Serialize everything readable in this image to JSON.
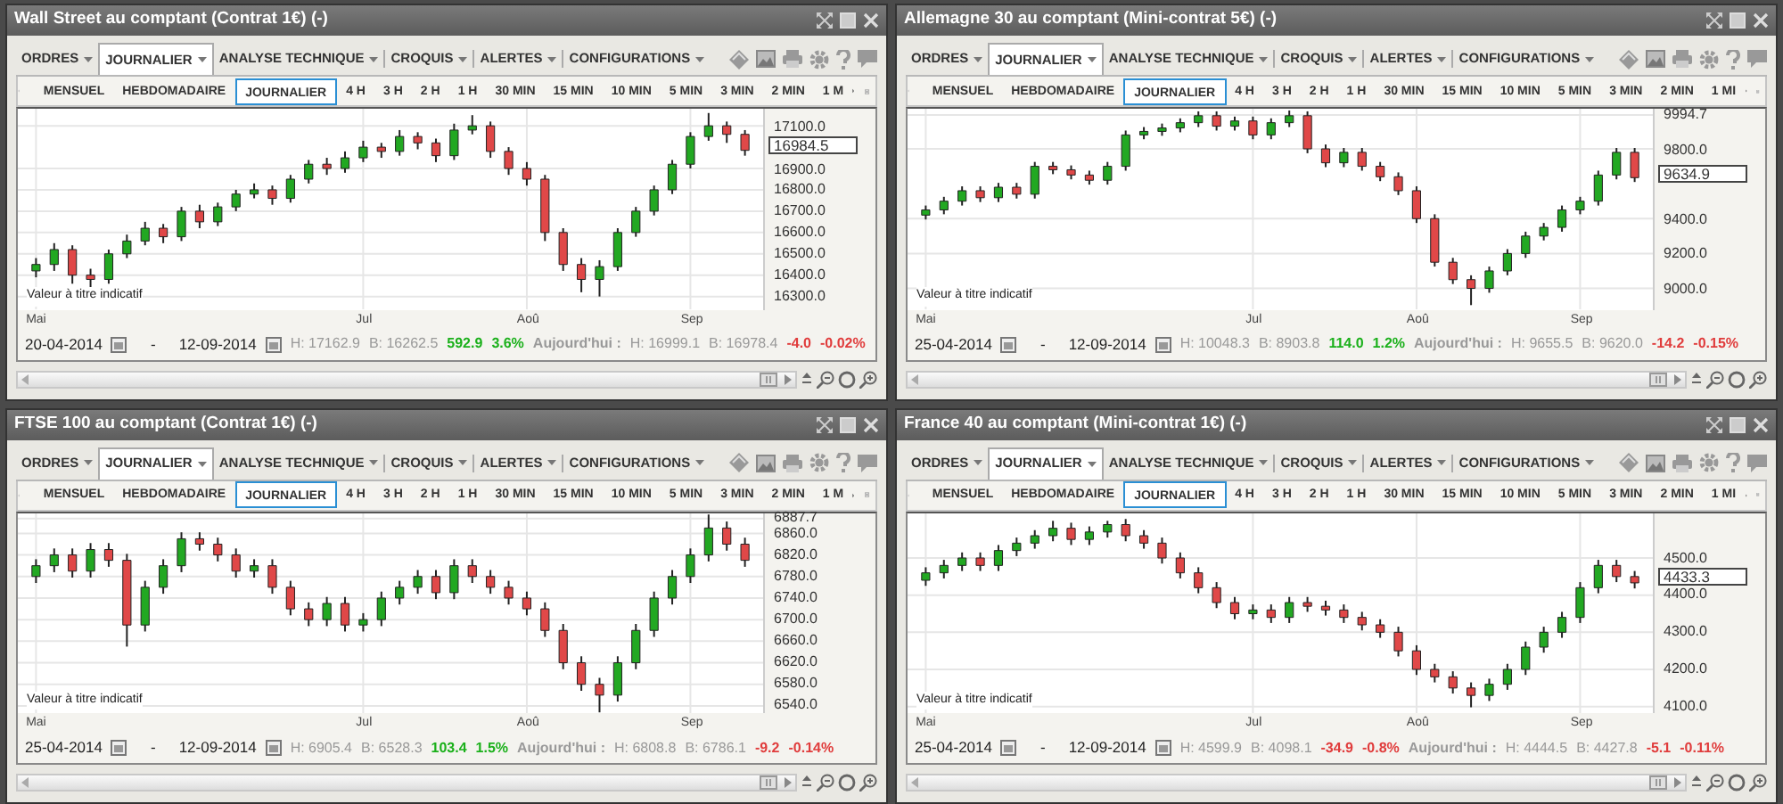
{
  "panels": [
    {
      "title": "Wall Street au comptant (Contrat 1€) (-)",
      "menu": [
        {
          "label": "ORDRES",
          "selected": false
        },
        {
          "label": "JOURNALIER",
          "selected": true
        },
        {
          "label": "ANALYSE TECHNIQUE",
          "selected": false
        },
        {
          "label": "CROQUIS",
          "selected": false
        },
        {
          "label": "ALERTES",
          "selected": false
        },
        {
          "label": "CONFIGURATIONS",
          "selected": false
        }
      ],
      "timeframes": [
        {
          "label": "MENSUEL",
          "selected": false
        },
        {
          "label": "HEBDOMADAIRE",
          "selected": false
        },
        {
          "label": "JOURNALIER",
          "selected": true
        },
        {
          "label": "4 H",
          "selected": false
        },
        {
          "label": "3 H",
          "selected": false
        },
        {
          "label": "2 H",
          "selected": false
        },
        {
          "label": "1 H",
          "selected": false
        },
        {
          "label": "30 MIN",
          "selected": false
        },
        {
          "label": "15 MIN",
          "selected": false
        },
        {
          "label": "10 MIN",
          "selected": false
        },
        {
          "label": "5 MIN",
          "selected": false
        },
        {
          "label": "3 MIN",
          "selected": false
        },
        {
          "label": "2 MIN",
          "selected": false
        },
        {
          "label": "1 M",
          "selected": false
        }
      ],
      "chart_data": {
        "type": "candlestick",
        "grid": true,
        "categories": [
          "Mai",
          null,
          null,
          null,
          null,
          null,
          null,
          null,
          null,
          null,
          null,
          null,
          null,
          null,
          null,
          null,
          null,
          null,
          "Jul",
          null,
          null,
          null,
          null,
          null,
          null,
          null,
          null,
          "Aoû",
          null,
          null,
          null,
          null,
          null,
          null,
          null,
          null,
          "Sep",
          null,
          null,
          null
        ],
        "ylim": [
          16240,
          17180
        ],
        "yticks": [
          {
            "value": 17100,
            "label": "17100.0"
          },
          {
            "value": 16900,
            "label": "16900.0"
          },
          {
            "value": 16800,
            "label": "16800.0"
          },
          {
            "value": 16700,
            "label": "16700.0"
          },
          {
            "value": 16600,
            "label": "16600.0"
          },
          {
            "value": 16500,
            "label": "16500.0"
          },
          {
            "value": 16400,
            "label": "16400.0"
          },
          {
            "value": 16300,
            "label": "16300.0"
          }
        ],
        "ohlc": [
          [
            16420,
            16480,
            16390,
            16450
          ],
          [
            16450,
            16550,
            16420,
            16520
          ],
          [
            16520,
            16540,
            16360,
            16400
          ],
          [
            16400,
            16430,
            16340,
            16380
          ],
          [
            16380,
            16520,
            16360,
            16500
          ],
          [
            16500,
            16590,
            16480,
            16560
          ],
          [
            16560,
            16650,
            16540,
            16620
          ],
          [
            16620,
            16640,
            16550,
            16580
          ],
          [
            16580,
            16720,
            16560,
            16700
          ],
          [
            16700,
            16730,
            16620,
            16650
          ],
          [
            16650,
            16740,
            16630,
            16720
          ],
          [
            16720,
            16800,
            16700,
            16780
          ],
          [
            16780,
            16830,
            16760,
            16800
          ],
          [
            16800,
            16820,
            16730,
            16760
          ],
          [
            16760,
            16870,
            16740,
            16850
          ],
          [
            16850,
            16940,
            16830,
            16920
          ],
          [
            16920,
            16950,
            16870,
            16900
          ],
          [
            16900,
            16980,
            16880,
            16950
          ],
          [
            16950,
            17030,
            16930,
            17000
          ],
          [
            17000,
            17020,
            16950,
            16980
          ],
          [
            16980,
            17080,
            16960,
            17050
          ],
          [
            17050,
            17070,
            16990,
            17020
          ],
          [
            17020,
            17040,
            16930,
            16960
          ],
          [
            16960,
            17110,
            16940,
            17080
          ],
          [
            17080,
            17150,
            17060,
            17100
          ],
          [
            17100,
            17120,
            16950,
            16980
          ],
          [
            16980,
            17000,
            16870,
            16900
          ],
          [
            16900,
            16930,
            16820,
            16850
          ],
          [
            16850,
            16870,
            16560,
            16600
          ],
          [
            16600,
            16620,
            16420,
            16450
          ],
          [
            16450,
            16480,
            16320,
            16380
          ],
          [
            16380,
            16470,
            16300,
            16440
          ],
          [
            16440,
            16620,
            16420,
            16600
          ],
          [
            16600,
            16720,
            16580,
            16700
          ],
          [
            16700,
            16820,
            16680,
            16800
          ],
          [
            16800,
            16940,
            16780,
            16920
          ],
          [
            16920,
            17070,
            16900,
            17050
          ],
          [
            17050,
            17160,
            17030,
            17100
          ],
          [
            17100,
            17120,
            17020,
            17060
          ],
          [
            17060,
            17080,
            16960,
            16985
          ]
        ]
      },
      "price": "16984.5",
      "note": "Valeur à titre indicatif",
      "footer": {
        "from": "20-04-2014",
        "separator": "-",
        "to": "12-09-2014",
        "high": "H: 17162.9",
        "low": "B: 16262.5",
        "change": {
          "value": "592.9",
          "percent": "3.6%",
          "color": "#1bb01b"
        },
        "today_label": "Aujourd'hui :",
        "today_high": "H: 16999.1",
        "today_low": "B: 16978.4",
        "today_change": {
          "value": "-4.0",
          "percent": "-0.02%",
          "color": "#e03c3c"
        }
      }
    },
    {
      "title": "Allemagne 30 au comptant (Mini-contrat 5€) (-)",
      "menu": [
        {
          "label": "ORDRES",
          "selected": false
        },
        {
          "label": "JOURNALIER",
          "selected": true
        },
        {
          "label": "ANALYSE TECHNIQUE",
          "selected": false
        },
        {
          "label": "CROQUIS",
          "selected": false
        },
        {
          "label": "ALERTES",
          "selected": false
        },
        {
          "label": "CONFIGURATIONS",
          "selected": false
        }
      ],
      "timeframes": [
        {
          "label": "MENSUEL",
          "selected": false
        },
        {
          "label": "HEBDOMADAIRE",
          "selected": false
        },
        {
          "label": "JOURNALIER",
          "selected": true
        },
        {
          "label": "4 H",
          "selected": false
        },
        {
          "label": "3 H",
          "selected": false
        },
        {
          "label": "2 H",
          "selected": false
        },
        {
          "label": "1 H",
          "selected": false
        },
        {
          "label": "30 MIN",
          "selected": false
        },
        {
          "label": "15 MIN",
          "selected": false
        },
        {
          "label": "10 MIN",
          "selected": false
        },
        {
          "label": "5 MIN",
          "selected": false
        },
        {
          "label": "3 MIN",
          "selected": false
        },
        {
          "label": "2 MIN",
          "selected": false
        },
        {
          "label": "1 MI",
          "selected": false
        }
      ],
      "chart_data": {
        "type": "candlestick",
        "grid": true,
        "categories": [
          "Mai",
          null,
          null,
          null,
          null,
          null,
          null,
          null,
          null,
          null,
          null,
          null,
          null,
          null,
          null,
          null,
          null,
          null,
          "Jul",
          null,
          null,
          null,
          null,
          null,
          null,
          null,
          null,
          "Aoû",
          null,
          null,
          null,
          null,
          null,
          null,
          null,
          null,
          "Sep",
          null,
          null,
          null
        ],
        "ylim": [
          8880,
          10030
        ],
        "yticks": [
          {
            "value": 9994.7,
            "label": "9994.7"
          },
          {
            "value": 9800,
            "label": "9800.0"
          },
          {
            "value": 9400,
            "label": "9400.0"
          },
          {
            "value": 9200,
            "label": "9200.0"
          },
          {
            "value": 9000,
            "label": "9000.0"
          }
        ],
        "ohlc": [
          [
            9420,
            9475,
            9395,
            9450
          ],
          [
            9450,
            9525,
            9425,
            9500
          ],
          [
            9500,
            9585,
            9475,
            9560
          ],
          [
            9560,
            9585,
            9495,
            9520
          ],
          [
            9520,
            9605,
            9495,
            9580
          ],
          [
            9580,
            9605,
            9515,
            9540
          ],
          [
            9540,
            9725,
            9515,
            9700
          ],
          [
            9700,
            9725,
            9655,
            9680
          ],
          [
            9680,
            9705,
            9625,
            9650
          ],
          [
            9650,
            9675,
            9595,
            9620
          ],
          [
            9620,
            9725,
            9595,
            9700
          ],
          [
            9700,
            9905,
            9675,
            9880
          ],
          [
            9880,
            9925,
            9855,
            9900
          ],
          [
            9900,
            9945,
            9875,
            9920
          ],
          [
            9920,
            9975,
            9895,
            9950
          ],
          [
            9950,
            10015,
            9925,
            9990
          ],
          [
            9990,
            10015,
            9905,
            9930
          ],
          [
            9930,
            9985,
            9905,
            9960
          ],
          [
            9960,
            9985,
            9855,
            9880
          ],
          [
            9880,
            9975,
            9855,
            9950
          ],
          [
            9950,
            10020,
            9925,
            9990
          ],
          [
            9990,
            10015,
            9775,
            9800
          ],
          [
            9800,
            9825,
            9695,
            9720
          ],
          [
            9720,
            9805,
            9695,
            9780
          ],
          [
            9780,
            9805,
            9675,
            9700
          ],
          [
            9700,
            9725,
            9615,
            9640
          ],
          [
            9640,
            9665,
            9535,
            9560
          ],
          [
            9560,
            9585,
            9375,
            9400
          ],
          [
            9400,
            9425,
            9125,
            9150
          ],
          [
            9150,
            9175,
            9025,
            9050
          ],
          [
            9050,
            9075,
            8904,
            9000
          ],
          [
            9000,
            9125,
            8975,
            9100
          ],
          [
            9100,
            9225,
            9075,
            9200
          ],
          [
            9200,
            9325,
            9175,
            9300
          ],
          [
            9300,
            9375,
            9275,
            9350
          ],
          [
            9350,
            9475,
            9325,
            9450
          ],
          [
            9450,
            9525,
            9425,
            9500
          ],
          [
            9500,
            9675,
            9475,
            9650
          ],
          [
            9650,
            9805,
            9625,
            9780
          ],
          [
            9780,
            9805,
            9610,
            9635
          ]
        ]
      },
      "price": "9634.9",
      "note": "Valeur à titre indicatif",
      "footer": {
        "from": "25-04-2014",
        "separator": "-",
        "to": "12-09-2014",
        "high": "H: 10048.3",
        "low": "B: 8903.8",
        "change": {
          "value": "114.0",
          "percent": "1.2%",
          "color": "#1bb01b"
        },
        "today_label": "Aujourd'hui :",
        "today_high": "H: 9655.5",
        "today_low": "B: 9620.0",
        "today_change": {
          "value": "-14.2",
          "percent": "-0.15%",
          "color": "#e03c3c"
        }
      }
    },
    {
      "title": "FTSE 100 au comptant (Contrat 1€) (-)",
      "menu": [
        {
          "label": "ORDRES",
          "selected": false
        },
        {
          "label": "JOURNALIER",
          "selected": true
        },
        {
          "label": "ANALYSE TECHNIQUE",
          "selected": false
        },
        {
          "label": "CROQUIS",
          "selected": false
        },
        {
          "label": "ALERTES",
          "selected": false
        },
        {
          "label": "CONFIGURATIONS",
          "selected": false
        }
      ],
      "timeframes": [
        {
          "label": "MENSUEL",
          "selected": false
        },
        {
          "label": "HEBDOMADAIRE",
          "selected": false
        },
        {
          "label": "JOURNALIER",
          "selected": true
        },
        {
          "label": "4 H",
          "selected": false
        },
        {
          "label": "3 H",
          "selected": false
        },
        {
          "label": "2 H",
          "selected": false
        },
        {
          "label": "1 H",
          "selected": false
        },
        {
          "label": "30 MIN",
          "selected": false
        },
        {
          "label": "15 MIN",
          "selected": false
        },
        {
          "label": "10 MIN",
          "selected": false
        },
        {
          "label": "5 MIN",
          "selected": false
        },
        {
          "label": "3 MIN",
          "selected": false
        },
        {
          "label": "2 MIN",
          "selected": false
        },
        {
          "label": "1 M",
          "selected": false
        }
      ],
      "chart_data": {
        "type": "candlestick",
        "grid": true,
        "categories": [
          "Mai",
          null,
          null,
          null,
          null,
          null,
          null,
          null,
          null,
          null,
          null,
          null,
          null,
          null,
          null,
          null,
          null,
          null,
          "Jul",
          null,
          null,
          null,
          null,
          null,
          null,
          null,
          null,
          "Aoû",
          null,
          null,
          null,
          null,
          null,
          null,
          null,
          null,
          "Sep",
          null,
          null,
          null
        ],
        "ylim": [
          6525,
          6897
        ],
        "yticks": [
          {
            "value": 6887.7,
            "label": "6887.7"
          },
          {
            "value": 6860,
            "label": "6860.0"
          },
          {
            "value": 6820,
            "label": "6820.0"
          },
          {
            "value": 6780,
            "label": "6780.0"
          },
          {
            "value": 6740,
            "label": "6740.0"
          },
          {
            "value": 6700,
            "label": "6700.0"
          },
          {
            "value": 6660,
            "label": "6660.0"
          },
          {
            "value": 6620,
            "label": "6620.0"
          },
          {
            "value": 6580,
            "label": "6580.0"
          },
          {
            "value": 6540,
            "label": "6540.0"
          }
        ],
        "ohlc": [
          [
            6780,
            6812,
            6768,
            6800
          ],
          [
            6800,
            6832,
            6788,
            6820
          ],
          [
            6820,
            6832,
            6778,
            6790
          ],
          [
            6790,
            6842,
            6778,
            6830
          ],
          [
            6830,
            6842,
            6798,
            6810
          ],
          [
            6810,
            6822,
            6650,
            6690
          ],
          [
            6690,
            6772,
            6678,
            6760
          ],
          [
            6760,
            6812,
            6748,
            6800
          ],
          [
            6800,
            6862,
            6788,
            6850
          ],
          [
            6850,
            6862,
            6828,
            6840
          ],
          [
            6840,
            6852,
            6808,
            6820
          ],
          [
            6820,
            6832,
            6778,
            6790
          ],
          [
            6790,
            6812,
            6778,
            6800
          ],
          [
            6800,
            6812,
            6748,
            6760
          ],
          [
            6760,
            6772,
            6708,
            6720
          ],
          [
            6720,
            6732,
            6688,
            6700
          ],
          [
            6700,
            6742,
            6688,
            6730
          ],
          [
            6730,
            6742,
            6678,
            6690
          ],
          [
            6690,
            6712,
            6678,
            6700
          ],
          [
            6700,
            6752,
            6688,
            6740
          ],
          [
            6740,
            6772,
            6728,
            6760
          ],
          [
            6760,
            6792,
            6748,
            6780
          ],
          [
            6780,
            6792,
            6738,
            6750
          ],
          [
            6750,
            6812,
            6738,
            6800
          ],
          [
            6800,
            6812,
            6768,
            6780
          ],
          [
            6780,
            6792,
            6748,
            6760
          ],
          [
            6760,
            6772,
            6728,
            6740
          ],
          [
            6740,
            6752,
            6708,
            6720
          ],
          [
            6720,
            6732,
            6668,
            6680
          ],
          [
            6680,
            6692,
            6608,
            6620
          ],
          [
            6620,
            6632,
            6568,
            6580
          ],
          [
            6580,
            6592,
            6528,
            6560
          ],
          [
            6560,
            6632,
            6548,
            6620
          ],
          [
            6620,
            6692,
            6608,
            6680
          ],
          [
            6680,
            6752,
            6668,
            6740
          ],
          [
            6740,
            6792,
            6728,
            6780
          ],
          [
            6780,
            6832,
            6768,
            6820
          ],
          [
            6820,
            6895,
            6808,
            6870
          ],
          [
            6870,
            6882,
            6828,
            6840
          ],
          [
            6840,
            6852,
            6798,
            6810
          ]
        ]
      },
      "note": "Valeur à titre indicatif",
      "footer": {
        "from": "25-04-2014",
        "separator": "-",
        "to": "12-09-2014",
        "high": "H: 6905.4",
        "low": "B: 6528.3",
        "change": {
          "value": "103.4",
          "percent": "1.5%",
          "color": "#1bb01b"
        },
        "today_label": "Aujourd'hui :",
        "today_high": "H: 6808.8",
        "today_low": "B: 6786.1",
        "today_change": {
          "value": "-9.2",
          "percent": "-0.14%",
          "color": "#e03c3c"
        }
      }
    },
    {
      "title": "France 40 au comptant (Mini-contrat 1€) (-)",
      "menu": [
        {
          "label": "ORDRES",
          "selected": false
        },
        {
          "label": "JOURNALIER",
          "selected": true
        },
        {
          "label": "ANALYSE TECHNIQUE",
          "selected": false
        },
        {
          "label": "CROQUIS",
          "selected": false
        },
        {
          "label": "ALERTES",
          "selected": false
        },
        {
          "label": "CONFIGURATIONS",
          "selected": false
        }
      ],
      "timeframes": [
        {
          "label": "MENSUEL",
          "selected": false
        },
        {
          "label": "HEBDOMADAIRE",
          "selected": false
        },
        {
          "label": "JOURNALIER",
          "selected": true
        },
        {
          "label": "4 H",
          "selected": false
        },
        {
          "label": "3 H",
          "selected": false
        },
        {
          "label": "2 H",
          "selected": false
        },
        {
          "label": "1 H",
          "selected": false
        },
        {
          "label": "30 MIN",
          "selected": false
        },
        {
          "label": "15 MIN",
          "selected": false
        },
        {
          "label": "10 MIN",
          "selected": false
        },
        {
          "label": "5 MIN",
          "selected": false
        },
        {
          "label": "3 MIN",
          "selected": false
        },
        {
          "label": "2 MIN",
          "selected": false
        },
        {
          "label": "1 MI",
          "selected": false
        }
      ],
      "chart_data": {
        "type": "candlestick",
        "grid": true,
        "categories": [
          "Mai",
          null,
          null,
          null,
          null,
          null,
          null,
          null,
          null,
          null,
          null,
          null,
          null,
          null,
          null,
          null,
          null,
          null,
          "Jul",
          null,
          null,
          null,
          null,
          null,
          null,
          null,
          null,
          "Aoû",
          null,
          null,
          null,
          null,
          null,
          null,
          null,
          null,
          "Sep",
          null,
          null,
          null
        ],
        "ylim": [
          4080,
          4620
        ],
        "yticks": [
          {
            "value": 4500,
            "label": "4500.0"
          },
          {
            "value": 4400,
            "label": "4400.0"
          },
          {
            "value": 4300,
            "label": "4300.0"
          },
          {
            "value": 4200,
            "label": "4200.0"
          },
          {
            "value": 4100,
            "label": "4100.0"
          }
        ],
        "ohlc": [
          [
            4440,
            4475,
            4425,
            4460
          ],
          [
            4460,
            4495,
            4445,
            4480
          ],
          [
            4480,
            4515,
            4465,
            4500
          ],
          [
            4500,
            4515,
            4465,
            4480
          ],
          [
            4480,
            4535,
            4465,
            4520
          ],
          [
            4520,
            4555,
            4505,
            4540
          ],
          [
            4540,
            4575,
            4525,
            4560
          ],
          [
            4560,
            4600,
            4545,
            4580
          ],
          [
            4580,
            4595,
            4535,
            4550
          ],
          [
            4550,
            4585,
            4535,
            4570
          ],
          [
            4570,
            4600,
            4555,
            4590
          ],
          [
            4590,
            4605,
            4545,
            4560
          ],
          [
            4560,
            4575,
            4525,
            4540
          ],
          [
            4540,
            4555,
            4485,
            4500
          ],
          [
            4500,
            4515,
            4445,
            4460
          ],
          [
            4460,
            4475,
            4405,
            4420
          ],
          [
            4420,
            4435,
            4365,
            4380
          ],
          [
            4380,
            4395,
            4335,
            4350
          ],
          [
            4350,
            4375,
            4335,
            4360
          ],
          [
            4360,
            4375,
            4325,
            4340
          ],
          [
            4340,
            4395,
            4325,
            4380
          ],
          [
            4380,
            4395,
            4355,
            4370
          ],
          [
            4370,
            4385,
            4345,
            4360
          ],
          [
            4360,
            4375,
            4325,
            4340
          ],
          [
            4340,
            4355,
            4305,
            4320
          ],
          [
            4320,
            4335,
            4285,
            4300
          ],
          [
            4300,
            4315,
            4235,
            4250
          ],
          [
            4250,
            4265,
            4185,
            4200
          ],
          [
            4200,
            4215,
            4165,
            4180
          ],
          [
            4180,
            4195,
            4135,
            4150
          ],
          [
            4150,
            4165,
            4098,
            4130
          ],
          [
            4130,
            4175,
            4115,
            4160
          ],
          [
            4160,
            4215,
            4145,
            4200
          ],
          [
            4200,
            4275,
            4185,
            4260
          ],
          [
            4260,
            4315,
            4245,
            4300
          ],
          [
            4300,
            4355,
            4285,
            4340
          ],
          [
            4340,
            4435,
            4325,
            4420
          ],
          [
            4420,
            4495,
            4405,
            4480
          ],
          [
            4480,
            4495,
            4435,
            4450
          ],
          [
            4450,
            4465,
            4418,
            4433
          ]
        ]
      },
      "price": "4433.3",
      "note": "Valeur à titre indicatif",
      "footer": {
        "from": "25-04-2014",
        "separator": "-",
        "to": "12-09-2014",
        "high": "H: 4599.9",
        "low": "B: 4098.1",
        "change": {
          "value": "-34.9",
          "percent": "-0.8%",
          "color": "#e03c3c"
        },
        "today_label": "Aujourd'hui :",
        "today_high": "H: 4444.5",
        "today_low": "B: 4427.8",
        "today_change": {
          "value": "-5.1",
          "percent": "-0.11%",
          "color": "#e03c3c"
        }
      }
    }
  ]
}
